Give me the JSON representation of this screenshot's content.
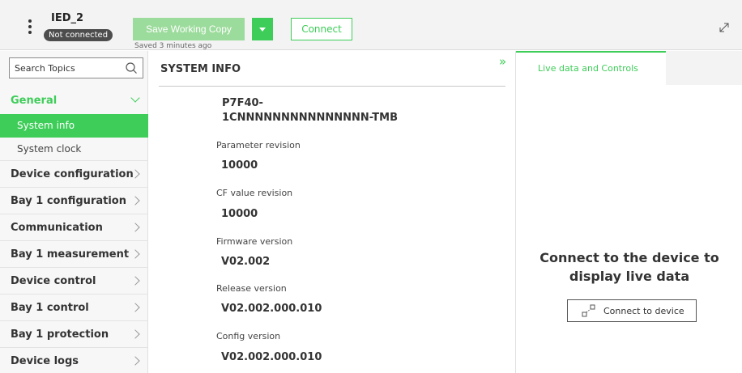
{
  "header": {
    "device_name": "IED_2",
    "status_badge": "Not connected",
    "save_button_label": "Save Working Copy",
    "saved_note": "Saved 3 minutes ago",
    "connect_button_label": "Connect"
  },
  "sidebar": {
    "search_placeholder": "Search Topics",
    "general_label": "General",
    "sub_items": [
      "System info",
      "System clock"
    ],
    "items": [
      "Device configuration",
      "Bay 1 configuration",
      "Communication",
      "Bay 1 measurement",
      "Device control",
      "Bay 1 control",
      "Bay 1 protection",
      "Device logs"
    ]
  },
  "main": {
    "title": "SYSTEM INFO",
    "model_line1": "P7F40-",
    "model_line2": "1CNNNNNNNNNNNNNNN-TMB",
    "fields": [
      {
        "label": "Parameter revision",
        "value": "10000"
      },
      {
        "label": "CF value revision",
        "value": "10000"
      },
      {
        "label": "Firmware version",
        "value": "V02.002"
      },
      {
        "label": "Release version",
        "value": "V02.002.000.010"
      },
      {
        "label": "Config version",
        "value": "V02.002.000.010"
      }
    ]
  },
  "right_panel": {
    "tab_label": "Live data and Controls",
    "empty_message_line1": "Connect to the device to",
    "empty_message_line2": "display live data",
    "connect_device_label": "Connect to device"
  },
  "colors": {
    "accent": "#3dcd58",
    "accent_disabled": "#9bdb9b",
    "badge": "#4d4d4d"
  }
}
